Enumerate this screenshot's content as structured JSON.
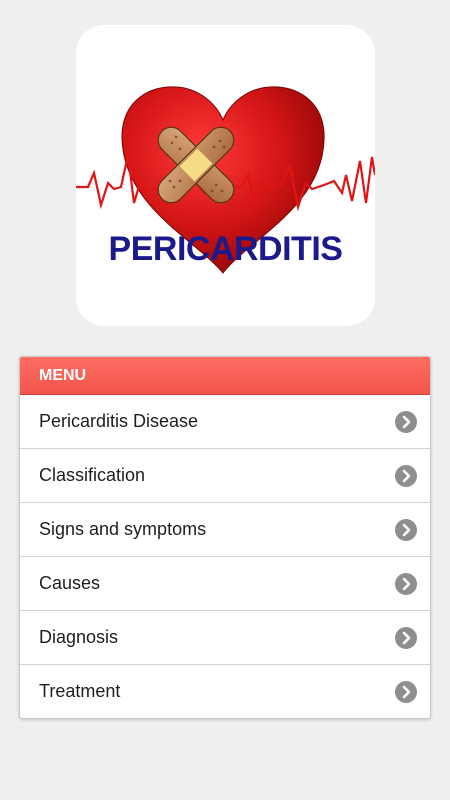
{
  "logo": {
    "text": "PERICARDITIS",
    "icon": "heart-with-bandage-icon",
    "heart_color": "#d91d1d",
    "text_color": "#1a1a8c"
  },
  "menu": {
    "header": "MENU",
    "header_color": "#f75b51",
    "items": [
      {
        "label": "Pericarditis Disease",
        "icon": "chevron-right-circle-icon"
      },
      {
        "label": "Classification",
        "icon": "chevron-right-circle-icon"
      },
      {
        "label": "Signs and symptoms",
        "icon": "chevron-right-circle-icon"
      },
      {
        "label": "Causes",
        "icon": "chevron-right-circle-icon"
      },
      {
        "label": "Diagnosis",
        "icon": "chevron-right-circle-icon"
      },
      {
        "label": "Treatment",
        "icon": "chevron-right-circle-icon"
      }
    ]
  }
}
